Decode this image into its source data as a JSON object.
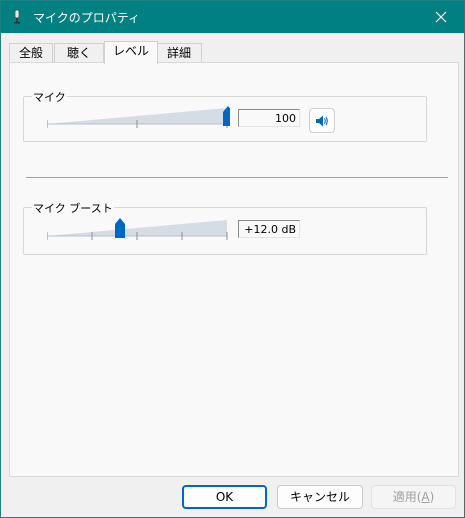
{
  "window": {
    "title": "マイクのプロパティ",
    "close_icon": "close-icon"
  },
  "tabs": [
    {
      "label": "全般"
    },
    {
      "label": "聴く"
    },
    {
      "label": "レベル"
    },
    {
      "label": "詳細"
    }
  ],
  "active_tab": "レベル",
  "mic": {
    "label": "マイク",
    "value_text": "100",
    "level": 1.0,
    "mute_icon": "speaker-icon"
  },
  "boost": {
    "label": "マイク ブースト",
    "value_text": "+12.0 dB",
    "level": 0.4
  },
  "buttons": {
    "ok": "OK",
    "cancel": "キャンセル",
    "apply": "適用",
    "apply_mnemonic": "A"
  },
  "colors": {
    "titlebar": "#008080",
    "accent": "#0067c0"
  }
}
